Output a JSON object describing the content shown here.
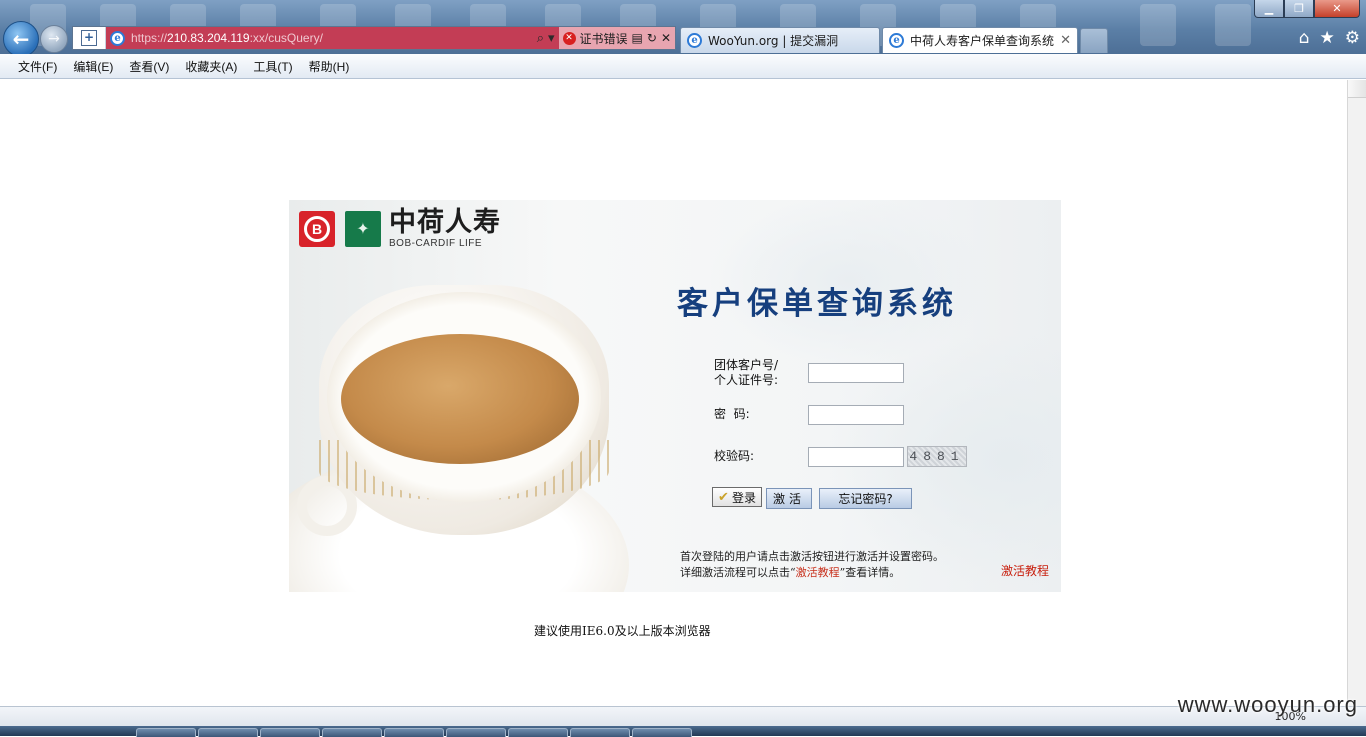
{
  "browser": {
    "url_prefix": "https://",
    "url_host": "210.83.204.119",
    "url_path": ":xx/cusQuery/",
    "cert_error": "证书错误",
    "tabs": [
      {
        "title": "WooYun.org | 提交漏洞",
        "active": false
      },
      {
        "title": "中荷人寿客户保单查询系统",
        "active": true
      }
    ],
    "menu": [
      "文件(F)",
      "编辑(E)",
      "查看(V)",
      "收藏夹(A)",
      "工具(T)",
      "帮助(H)"
    ],
    "zoom": "100%",
    "watermark": "www.wooyun.org"
  },
  "page": {
    "logo_cn": "中荷人寿",
    "logo_en": "BOB-CARDIF LIFE",
    "logo_letter": "B",
    "title": "客户保单查询系统",
    "form": {
      "id_label_line1": "团体客户号/",
      "id_label_line2": "个人证件号:",
      "password_label": "密  码:",
      "captcha_label": "校验码:",
      "captcha_value": "4881",
      "id_value": "",
      "password_value": "",
      "captcha_input_value": ""
    },
    "buttons": {
      "login": "登录",
      "activate": "激活",
      "forgot": "忘记密码?"
    },
    "notes": {
      "line1": "首次登陆的用户请点击激活按钮进行激活并设置密码。",
      "line2_pre": "详细激活流程可以点击“",
      "line2_link": "激活教程",
      "line2_post": "”查看详情。"
    },
    "tutorial_link": "激活教程",
    "browser_advice": "建议使用IE6.0及以上版本浏览器"
  },
  "colors": {
    "title_blue": "#163f7e",
    "logo_red": "#d8232a",
    "logo_green": "#167a4a",
    "link_red": "#c8200f",
    "cert_error_bar": "#c33d55"
  }
}
